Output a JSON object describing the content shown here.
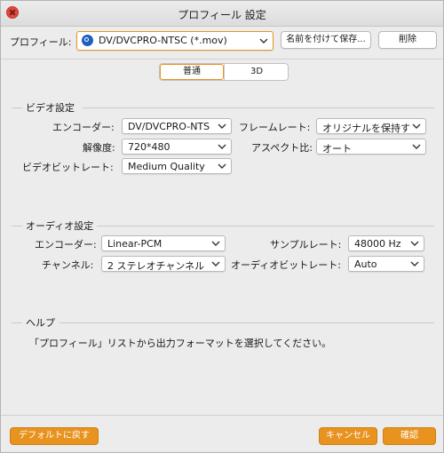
{
  "window": {
    "title": "プロフィール 設定"
  },
  "profile": {
    "label": "プロフィール:",
    "selected": "DV/DVCPRO-NTSC (*.mov)",
    "save_as_label": "名前を付けて保存...",
    "delete_label": "削除"
  },
  "tabs": [
    {
      "label": "普通",
      "active": true
    },
    {
      "label": "3D",
      "active": false
    }
  ],
  "video": {
    "title": "ビデオ設定",
    "encoder_label": "エンコーダー:",
    "encoder_value": "DV/DVCPRO-NTS",
    "framerate_label": "フレームレート:",
    "framerate_value": "オリジナルを保持す",
    "resolution_label": "解像度:",
    "resolution_value": "720*480",
    "aspect_label": "アスペクト比:",
    "aspect_value": "オート",
    "bitrate_label": "ビデオビットレート:",
    "bitrate_value": "Medium Quality"
  },
  "audio": {
    "title": "オーディオ設定",
    "encoder_label": "エンコーダー:",
    "encoder_value": "Linear-PCM",
    "samplerate_label": "サンプルレート:",
    "samplerate_value": "48000 Hz",
    "channel_label": "チャンネル:",
    "channel_value": "2 ステレオチャンネル",
    "bitrate_label": "オーディオビットレート:",
    "bitrate_value": "Auto"
  },
  "help": {
    "title": "ヘルプ",
    "text": "「プロフィール」リストから出力フォーマットを選択してください。"
  },
  "footer": {
    "default_label": "デフォルトに戻す",
    "cancel_label": "キャンセル",
    "ok_label": "確認"
  },
  "colors": {
    "accent": "#e8931f",
    "close": "#e04a3f"
  }
}
